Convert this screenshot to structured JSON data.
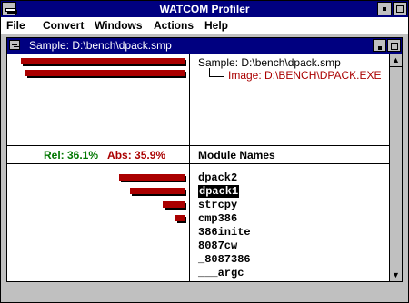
{
  "app": {
    "title": "WATCOM Profiler"
  },
  "menu": {
    "items": [
      {
        "label": "File",
        "mnemonic": "F"
      },
      {
        "label": "Convert",
        "mnemonic": "C"
      },
      {
        "label": "Windows",
        "mnemonic": "W"
      },
      {
        "label": "Actions",
        "mnemonic": "A"
      },
      {
        "label": "Help",
        "mnemonic": "H"
      }
    ]
  },
  "child_window": {
    "title": "Sample: D:\\bench\\dpack.smp"
  },
  "sample_info": {
    "sample_line": "Sample:   D:\\bench\\dpack.smp",
    "image_line": "Image:   D:\\BENCH\\DPACK.EXE"
  },
  "stats": {
    "rel": "Rel:  36.1%",
    "abs": "Abs:  35.9%"
  },
  "module_header": "Module Names",
  "modules": [
    {
      "name": "dpack2",
      "bar_fraction": 0.36
    },
    {
      "name": "dpack1",
      "bar_fraction": 0.3,
      "selected": true
    },
    {
      "name": "strcpy",
      "bar_fraction": 0.12
    },
    {
      "name": "cmp386",
      "bar_fraction": 0.05
    },
    {
      "name": "386inite",
      "bar_fraction": 0
    },
    {
      "name": "8087cw",
      "bar_fraction": 0
    },
    {
      "name": "_8087386",
      "bar_fraction": 0
    },
    {
      "name": "___argc",
      "bar_fraction": 0
    }
  ],
  "top_bars": [
    1.0,
    0.97
  ],
  "colors": {
    "titlebar": "#000080",
    "bar": "#aa0000",
    "rel": "#007700",
    "abs": "#aa0000"
  }
}
